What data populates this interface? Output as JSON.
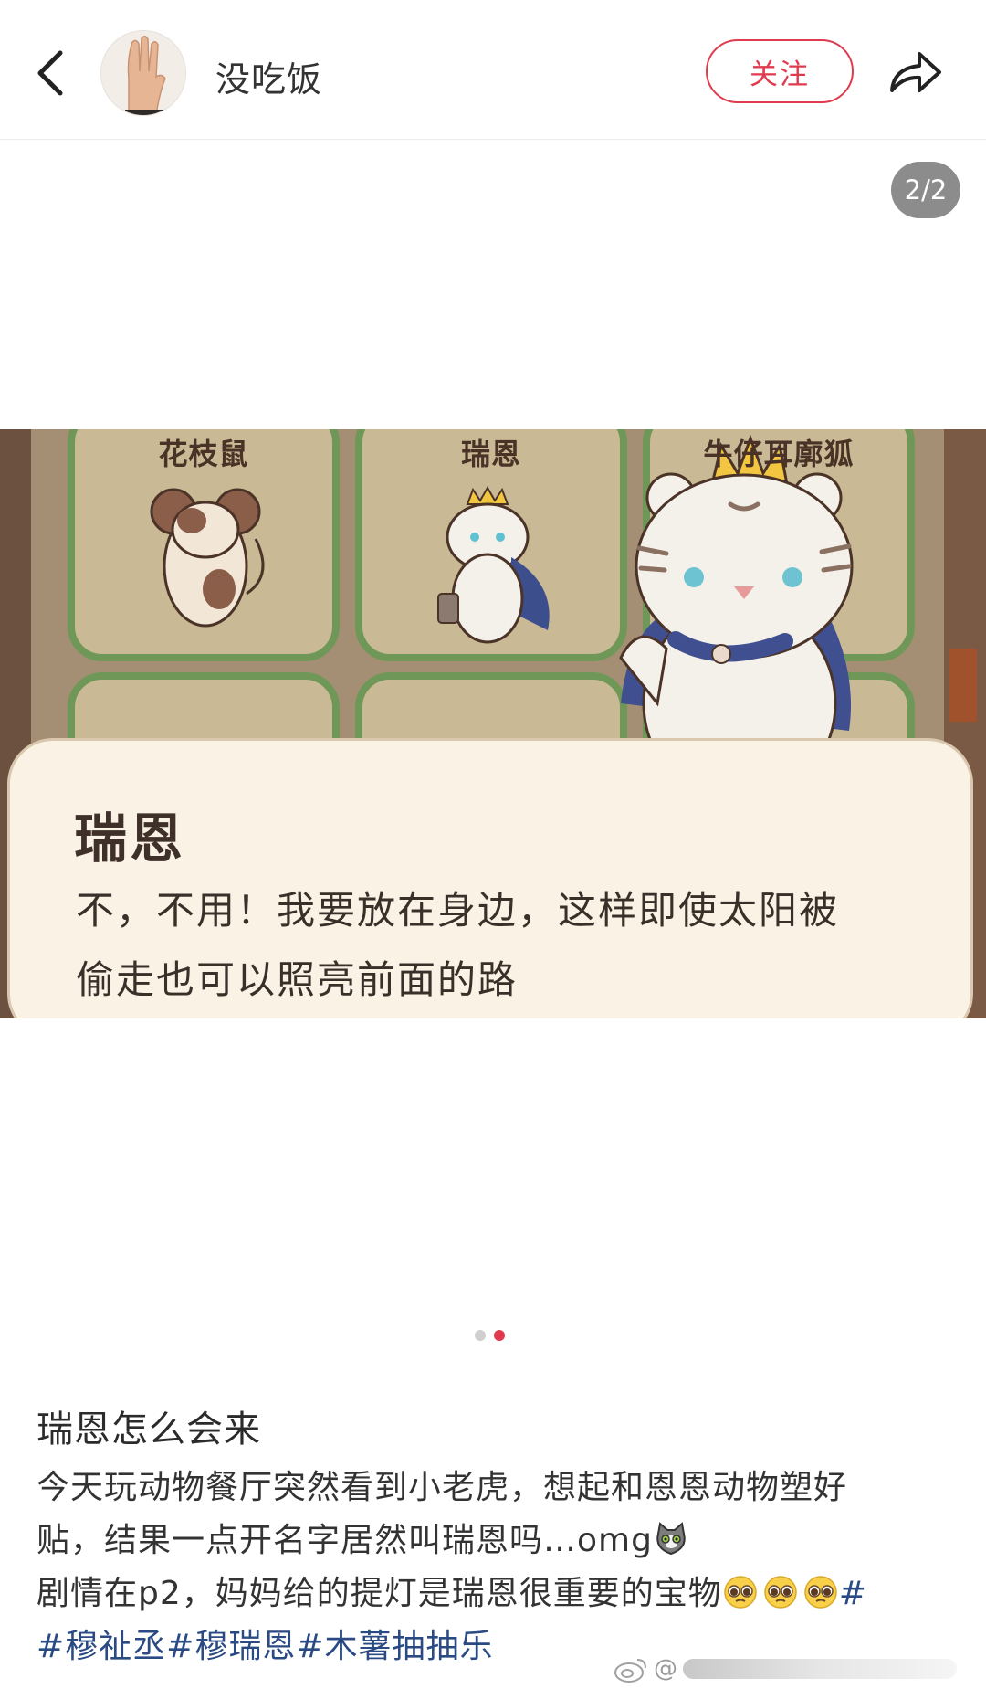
{
  "header": {
    "author_name": "没吃饭",
    "follow_label": "关注",
    "back_icon": "chevron-left-icon",
    "share_icon": "share-icon"
  },
  "media": {
    "page_counter": "2/2",
    "current_page": 2,
    "total_pages": 2,
    "game_image": {
      "cards": [
        {
          "label": "花枝鼠"
        },
        {
          "label": "瑞恩"
        },
        {
          "label": "牛仔耳廓狐"
        }
      ],
      "dialog": {
        "speaker": "瑞恩",
        "lines": [
          "不，不用！我要放在身边，这样即使太阳被",
          "偷走也可以照亮前面的路"
        ]
      }
    }
  },
  "post": {
    "title": "瑞恩怎么会来",
    "line1": "今天玩动物餐厅突然看到小老虎，想起和恩恩动物塑好",
    "line2": "贴，结果一点开名字居然叫瑞恩吗…omg",
    "line3": "剧情在p2，妈妈给的提灯是瑞恩很重要的宝物",
    "tags": [
      "#穆祉丞",
      "#穆瑞恩",
      "#木薯抽抽乐"
    ],
    "tag_hash": "#"
  },
  "watermark": {
    "text": "@"
  },
  "colors": {
    "accent": "#e03a4e",
    "link": "#2a4a83",
    "counter_bg": "#8c8c8c"
  }
}
